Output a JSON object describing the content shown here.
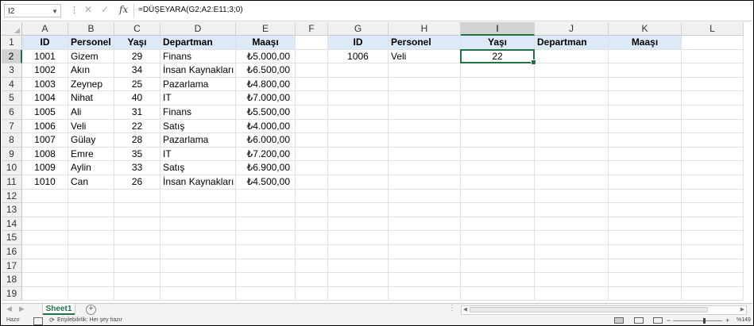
{
  "formula_bar": {
    "name_box": "I2",
    "formula": "=DÜŞEYARA(G2;A2:E11;3;0)",
    "fx": "fx",
    "cancel_icon": "close-icon",
    "enter_icon": "check-icon"
  },
  "columns": [
    "A",
    "B",
    "C",
    "D",
    "E",
    "F",
    "G",
    "H",
    "I",
    "J",
    "K",
    "L"
  ],
  "selected_column": "I",
  "rows": [
    "1",
    "2",
    "3",
    "4",
    "5",
    "6",
    "7",
    "8",
    "9",
    "10",
    "11",
    "12",
    "13",
    "14",
    "15",
    "16",
    "17",
    "18",
    "19"
  ],
  "selected_row": "2",
  "left_table": {
    "headers": [
      "ID",
      "Personel",
      "Yaşı",
      "Departman",
      "Maaşı"
    ],
    "records": [
      [
        "1001",
        "Gizem",
        "29",
        "Finans",
        "₺5.000,00"
      ],
      [
        "1002",
        "Akın",
        "34",
        "İnsan Kaynakları",
        "₺6.500,00"
      ],
      [
        "1003",
        "Zeynep",
        "25",
        "Pazarlama",
        "₺4.800,00"
      ],
      [
        "1004",
        "Nihat",
        "40",
        "IT",
        "₺7.000,00"
      ],
      [
        "1005",
        "Ali",
        "31",
        "Finans",
        "₺5.500,00"
      ],
      [
        "1006",
        "Veli",
        "22",
        "Satış",
        "₺4.000,00"
      ],
      [
        "1007",
        "Gülay",
        "28",
        "Pazarlama",
        "₺6.000,00"
      ],
      [
        "1008",
        "Emre",
        "35",
        "IT",
        "₺7.200,00"
      ],
      [
        "1009",
        "Aylin",
        "33",
        "Satış",
        "₺6.900,00"
      ],
      [
        "1010",
        "Can",
        "26",
        "İnsan Kaynakları",
        "₺4.500,00"
      ]
    ]
  },
  "lookup_table": {
    "headers": [
      "ID",
      "Personel",
      "Yaşı",
      "Departman",
      "Maaşı"
    ],
    "record": [
      "1006",
      "Veli",
      "22",
      "",
      ""
    ]
  },
  "sheet_tabs": {
    "active": "Sheet1",
    "add_icon": "plus-icon"
  },
  "status_bar": {
    "ready": "Hazır",
    "accessibility": "Erişilebilirlik: Her şey hazır",
    "zoom": "%149"
  },
  "colors": {
    "header_fill": "#dce9f6",
    "selection": "#217346"
  }
}
